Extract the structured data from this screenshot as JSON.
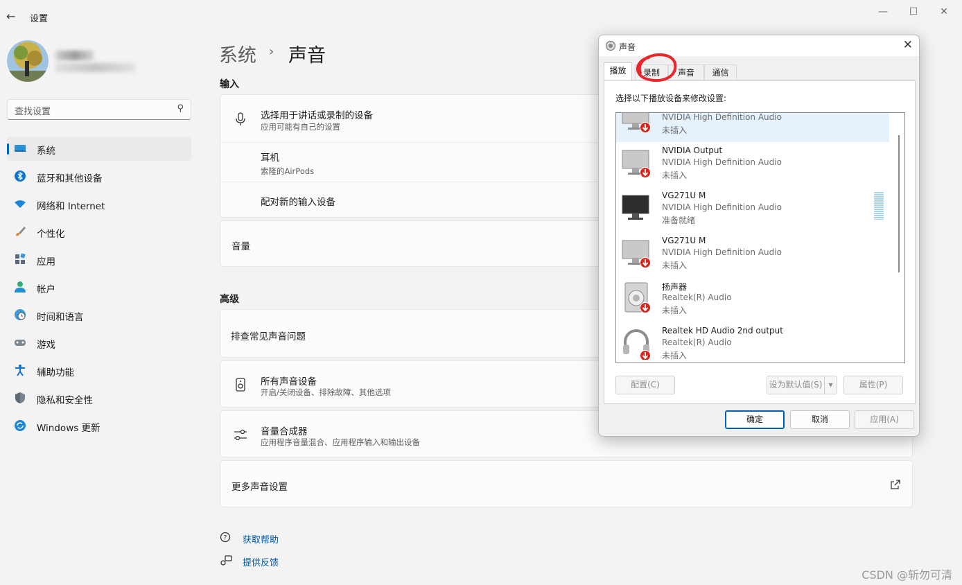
{
  "window": {
    "title": "设置",
    "controls": [
      "minimize",
      "maximize",
      "close"
    ]
  },
  "sidebar": {
    "search_placeholder": "查找设置",
    "items": [
      {
        "label": "系统",
        "icon": "system-icon",
        "active": true
      },
      {
        "label": "蓝牙和其他设备",
        "icon": "bluetooth-icon"
      },
      {
        "label": "网络和 Internet",
        "icon": "wifi-icon"
      },
      {
        "label": "个性化",
        "icon": "brush-icon"
      },
      {
        "label": "应用",
        "icon": "apps-icon"
      },
      {
        "label": "帐户",
        "icon": "account-icon"
      },
      {
        "label": "时间和语言",
        "icon": "globe-clock-icon"
      },
      {
        "label": "游戏",
        "icon": "gamepad-icon"
      },
      {
        "label": "辅助功能",
        "icon": "accessibility-icon"
      },
      {
        "label": "隐私和安全性",
        "icon": "shield-icon"
      },
      {
        "label": "Windows 更新",
        "icon": "update-icon"
      }
    ]
  },
  "breadcrumb": {
    "parent": "系统",
    "separator": "›",
    "current": "声音"
  },
  "main": {
    "input_heading": "输入",
    "input_card": {
      "title": "选择用于讲话或录制的设备",
      "subtitle": "应用可能有自己的设置",
      "device_name": "耳机",
      "device_sub": "索隆的AirPods",
      "pair_label": "配对新的输入设备"
    },
    "volume_label": "音量",
    "advanced_heading": "高级",
    "troubleshoot_label": "排查常见声音问题",
    "all_devices": {
      "title": "所有声音设备",
      "subtitle": "开启/关闭设备、排除故障、其他选项"
    },
    "mixer": {
      "title": "音量合成器",
      "subtitle": "应用程序音量混合、应用程序输入和输出设备"
    },
    "more_settings_label": "更多声音设置",
    "help_link": "获取帮助",
    "feedback_link": "提供反馈"
  },
  "dialog": {
    "title": "声音",
    "tabs": [
      "播放",
      "录制",
      "声音",
      "通信"
    ],
    "selected_tab": "播放",
    "instruction": "选择以下播放设备来修改设置:",
    "devices": [
      {
        "name": "",
        "driver": "NVIDIA High Definition Audio",
        "status": "未插入",
        "type": "monitor",
        "disconnected": true
      },
      {
        "name": "NVIDIA Output",
        "driver": "NVIDIA High Definition Audio",
        "status": "未插入",
        "type": "monitor",
        "disconnected": true
      },
      {
        "name": "VG271U M",
        "driver": "NVIDIA High Definition Audio",
        "status": "准备就绪",
        "type": "monitor-dark",
        "disconnected": false
      },
      {
        "name": "VG271U M",
        "driver": "NVIDIA High Definition Audio",
        "status": "未插入",
        "type": "monitor",
        "disconnected": true
      },
      {
        "name": "扬声器",
        "driver": "Realtek(R) Audio",
        "status": "未插入",
        "type": "speaker",
        "disconnected": true
      },
      {
        "name": "Realtek HD Audio 2nd output",
        "driver": "Realtek(R) Audio",
        "status": "未插入",
        "type": "headphones",
        "disconnected": true
      }
    ],
    "configure_btn": "配置(C)",
    "set_default_btn": "设为默认值(S)",
    "properties_btn": "属性(P)",
    "ok_btn": "确定",
    "cancel_btn": "取消",
    "apply_btn": "应用(A)"
  },
  "watermark": "CSDN @斩勿可清",
  "colors": {
    "accent": "#0067c0",
    "link": "#0057a8",
    "annotation": "#e8262b"
  }
}
